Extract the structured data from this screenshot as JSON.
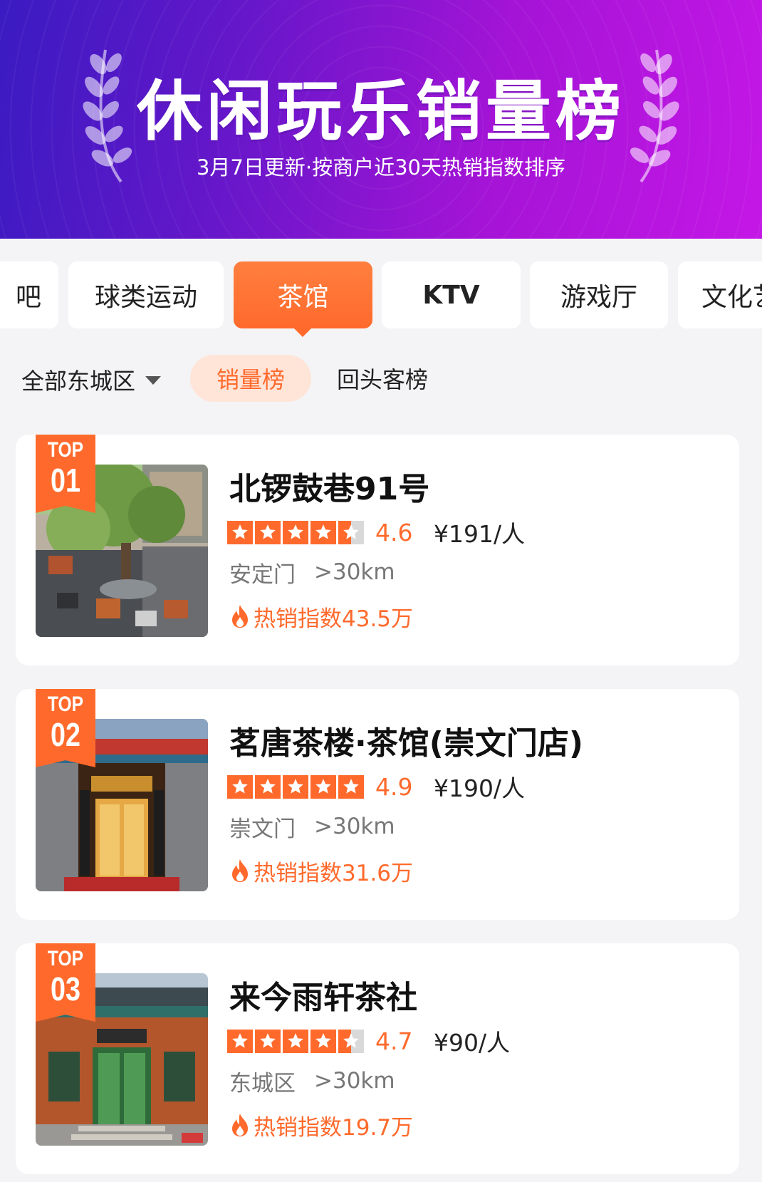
{
  "banner": {
    "title": "休闲玩乐销量榜",
    "subtitle": "3月7日更新·按商户近30天热销指数排序"
  },
  "categories": [
    {
      "label": "吧",
      "active": false
    },
    {
      "label": "球类运动",
      "active": false
    },
    {
      "label": "茶馆",
      "active": true
    },
    {
      "label": "KTV",
      "active": false
    },
    {
      "label": "游戏厅",
      "active": false
    },
    {
      "label": "文化艺",
      "active": false
    }
  ],
  "filter": {
    "area": "全部东城区",
    "rank_tabs": [
      "销量榜",
      "回头客榜"
    ],
    "active_tab": "销量榜"
  },
  "shops": [
    {
      "rank_top": "TOP",
      "rank_no": "01",
      "name": "北锣鼓巷91号",
      "rating": 4.6,
      "rating_text": "4.6",
      "price": "¥191/人",
      "area": "安定门",
      "distance": ">30km",
      "hot_index": "热销指数43.5万"
    },
    {
      "rank_top": "TOP",
      "rank_no": "02",
      "name": "茗唐茶楼·茶馆(崇文门店)",
      "rating": 4.9,
      "rating_text": "4.9",
      "price": "¥190/人",
      "area": "崇文门",
      "distance": ">30km",
      "hot_index": "热销指数31.6万"
    },
    {
      "rank_top": "TOP",
      "rank_no": "03",
      "name": "来今雨轩茶社",
      "rating": 4.7,
      "rating_text": "4.7",
      "price": "¥90/人",
      "area": "东城区",
      "distance": ">30km",
      "hot_index": "热销指数19.7万"
    }
  ],
  "colors": {
    "accent": "#ff6a2c",
    "accent_light": "#ffe4d8",
    "banner_start": "#3a1bc2",
    "banner_end": "#c417e6"
  }
}
